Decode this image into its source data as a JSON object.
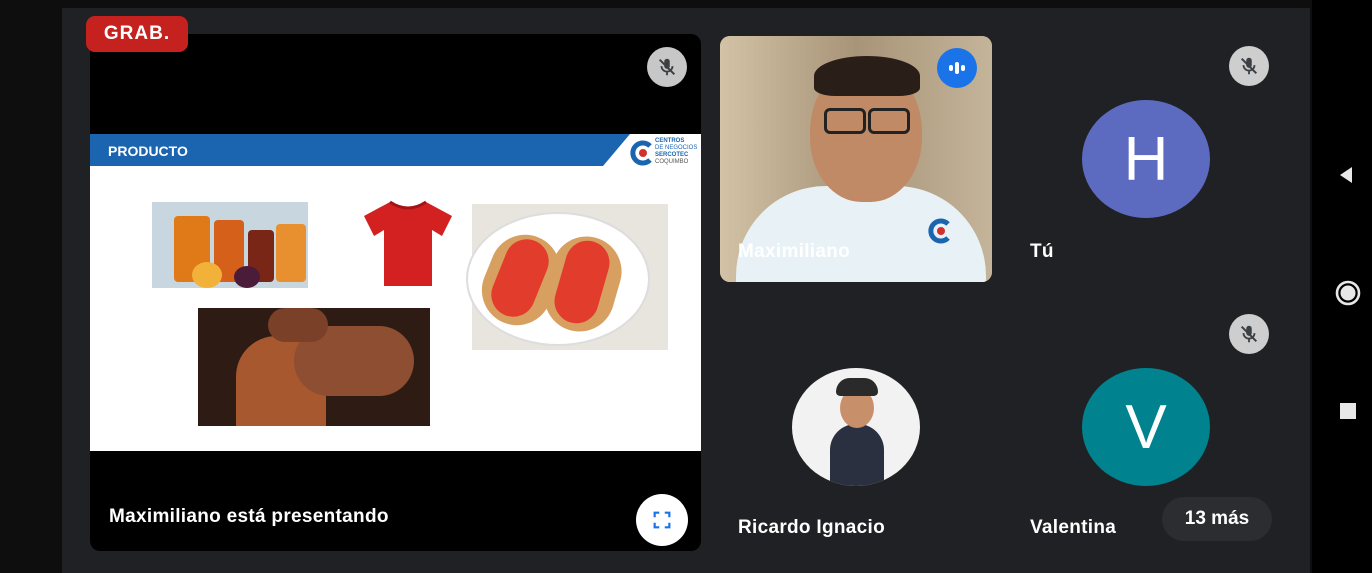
{
  "recording": {
    "label": "GRAB."
  },
  "presentation": {
    "presenter_caption": "Maximiliano  está presentando",
    "slide": {
      "header": "PRODUCTO",
      "logo_lines": [
        "CENTROS",
        "DE NEGOCIOS",
        "SERCOTEC",
        "COQUIMBO"
      ]
    }
  },
  "participants": [
    {
      "name": "Maximiliano",
      "status": "speaking"
    },
    {
      "name": "Tú",
      "initial": "H",
      "status": "muted"
    },
    {
      "name": "Ricardo Ignacio"
    },
    {
      "name": "Valentina",
      "initial": "V",
      "status": "muted"
    }
  ],
  "more": {
    "label": "13 más"
  },
  "colors": {
    "recording_red": "#c5221f",
    "slide_blue": "#1a64b0",
    "avatar_h": "#5c6bc0",
    "avatar_v": "#00838f",
    "speaking_blue": "#1a73e8"
  }
}
